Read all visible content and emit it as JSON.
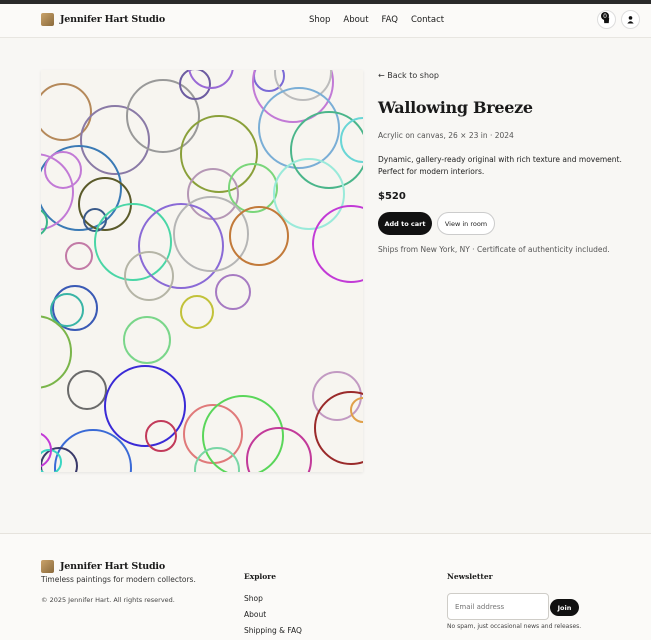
{
  "header": {
    "brand": "Jennifer Hart Studio",
    "nav": [
      "Shop",
      "About",
      "FAQ",
      "Contact"
    ],
    "cart_count": "0",
    "cart_icon": "shopping-bag-icon",
    "user_icon": "user-icon"
  },
  "artwork": {
    "description_icon": "abstract-circles-painting"
  },
  "product": {
    "back": "← Back to shop",
    "title": "Wallowing Breeze",
    "meta": "Acrylic on canvas, 26 × 23 in · 2024",
    "description": "Dynamic, gallery-ready original with rich texture and movement. Perfect for modern interiors.",
    "price": "$520",
    "add_to_cart": "Add to cart",
    "view_in_room": "View in room",
    "shipping": "Ships from New York, NY · Certificate of authenticity included."
  },
  "footer": {
    "brand": "Jennifer Hart Studio",
    "tagline": "Timeless paintings for modern collectors.",
    "copyright": "© 2025 Jennifer Hart. All rights reserved.",
    "explore_heading": "Explore",
    "explore_links": [
      "Shop",
      "About",
      "Shipping & FAQ"
    ],
    "newsletter_heading": "Newsletter",
    "email_placeholder": "Email address",
    "join": "Join",
    "nospam": "No spam, just occasional news and releases."
  }
}
